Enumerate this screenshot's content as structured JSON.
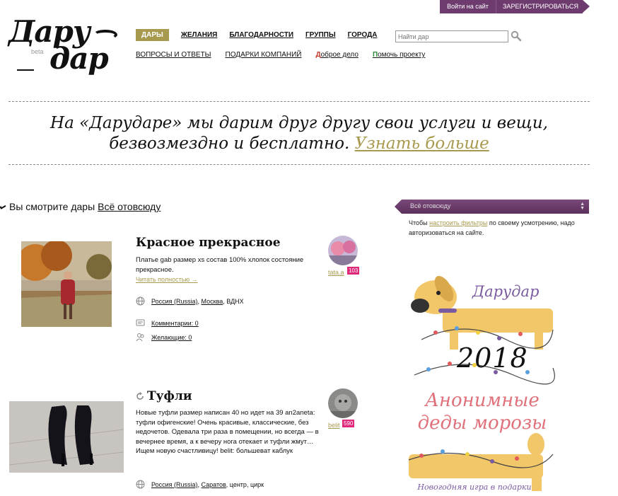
{
  "header": {
    "login_label": "Войти на сайт",
    "register_label": "ЗАРЕГИСТРИРОВАТЬСЯ",
    "logo_line1": "Дару",
    "logo_line2": "дар",
    "logo_beta": "beta"
  },
  "nav": {
    "primary": [
      "ДАРЫ",
      "ЖЕЛАНИЯ",
      "БЛАГОДАРНОСТИ",
      "ГРУППЫ",
      "ГОРОДА"
    ],
    "secondary": {
      "faq": "ВОПРОСЫ И ОТВЕТЫ",
      "company_gifts": "ПОДАРКИ КОМПАНИЙ",
      "good_deed_first": "Д",
      "good_deed_rest": "оброе дело",
      "help_first": "П",
      "help_rest": "омочь проекту"
    },
    "search_placeholder": "Найти дар"
  },
  "banner": {
    "line1": "На «Дарударе» мы дарим друг другу свои услуги и вещи,",
    "line2": "безвозмездно и бесплатно.",
    "more_link": "Узнать больше"
  },
  "viewing": {
    "prefix": "Вы смотрите дары",
    "link": "Всё отовсюду"
  },
  "sidebar": {
    "filter_value": "Всё отовсюду",
    "note_before": "Чтобы ",
    "note_link": "настроить фильтры",
    "note_after": " по своему усмотрению, надо авторизоваться на сайте.",
    "promo_title": "Дарудар",
    "promo_year": "2018",
    "promo_headline_1": "Анонимные",
    "promo_headline_2": "деды морозы",
    "promo_caption": "Новогодняя игра в подарки"
  },
  "gifts": [
    {
      "title": "Красное прекрасное",
      "description": "Платье gab размер xs состав 100% хлопок состояние прекрасное.",
      "read_more": "Читать полностью →",
      "country": "Россия (Russia)",
      "city": "Москва",
      "place": ", ВДНХ",
      "comments": "Комментарии: 0",
      "wishers": "Желающие: 0",
      "user": "tata.a",
      "karma": "103"
    },
    {
      "title": "Туфли",
      "description": "Новые туфли размер написан 40 но идет на 39 an2aneta: туфли офигенские! Очень красивые, классические, без недочетов. Одевала три раза в помещении, но всегда — в вечернее время, а к вечеру нога отекает и туфли жмут… Ищем новую счастливицу! belit: большеват каблук",
      "country": "Россия (Russia)",
      "city": "Саратов",
      "place": ", центр, цирк",
      "user": "belit",
      "karma": "590"
    }
  ],
  "colors": {
    "accent_olive": "#a79a4f",
    "purple": "#6e3b6e",
    "karma_pink": "#e0287a",
    "promo_pink": "#e0707a",
    "promo_violet": "#7a5aa0"
  }
}
